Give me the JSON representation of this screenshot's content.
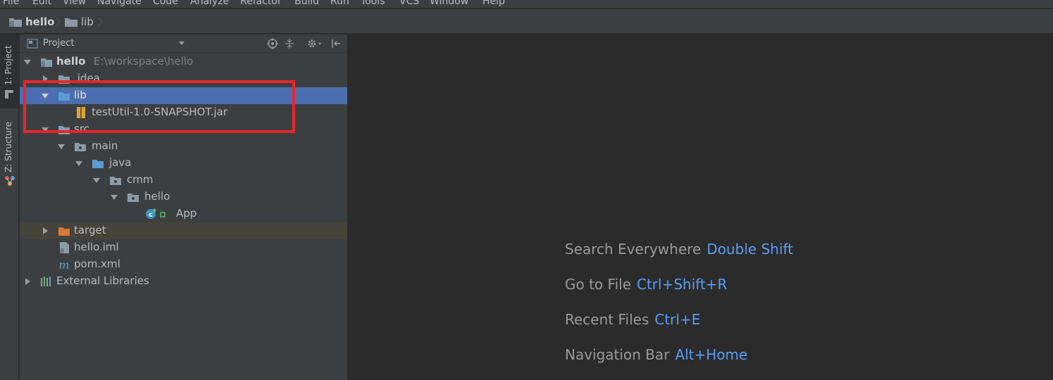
{
  "menu": [
    "File",
    "Edit",
    "View",
    "Navigate",
    "Code",
    "Analyze",
    "Refactor",
    "Build",
    "Run",
    "Tools",
    "VCS",
    "Window",
    "Help"
  ],
  "breadcrumb": [
    "hello",
    "lib"
  ],
  "tool_strip": {
    "project_tab": "1: Project",
    "structure_tab": "Z: Structure"
  },
  "project_panel": {
    "title": "Project",
    "view_mode_icon": "chevron-down-icon"
  },
  "tree": {
    "root_name": "hello",
    "root_path": "E:\\workspace\\hello",
    "idea": ".idea",
    "lib": "lib",
    "jar": "testUtil-1.0-SNAPSHOT.jar",
    "src": "src",
    "main": "main",
    "java": "java",
    "cmm": "cmm",
    "hello_pkg": "hello",
    "app": "App",
    "target": "target",
    "iml": "hello.iml",
    "pom": "pom.xml",
    "ext_libs": "External Libraries"
  },
  "editor_hints": [
    {
      "label": "Search Everywhere",
      "shortcut": "Double Shift"
    },
    {
      "label": "Go to File",
      "shortcut": "Ctrl+Shift+R"
    },
    {
      "label": "Recent Files",
      "shortcut": "Ctrl+E"
    },
    {
      "label": "Navigation Bar",
      "shortcut": "Alt+Home"
    }
  ],
  "colors": {
    "selection": "#4b6eaf",
    "highlight_box": "#e9262a",
    "shortcut_text": "#589df6",
    "folder_blue": "#5b9bd5",
    "folder_orange": "#d77a36"
  }
}
